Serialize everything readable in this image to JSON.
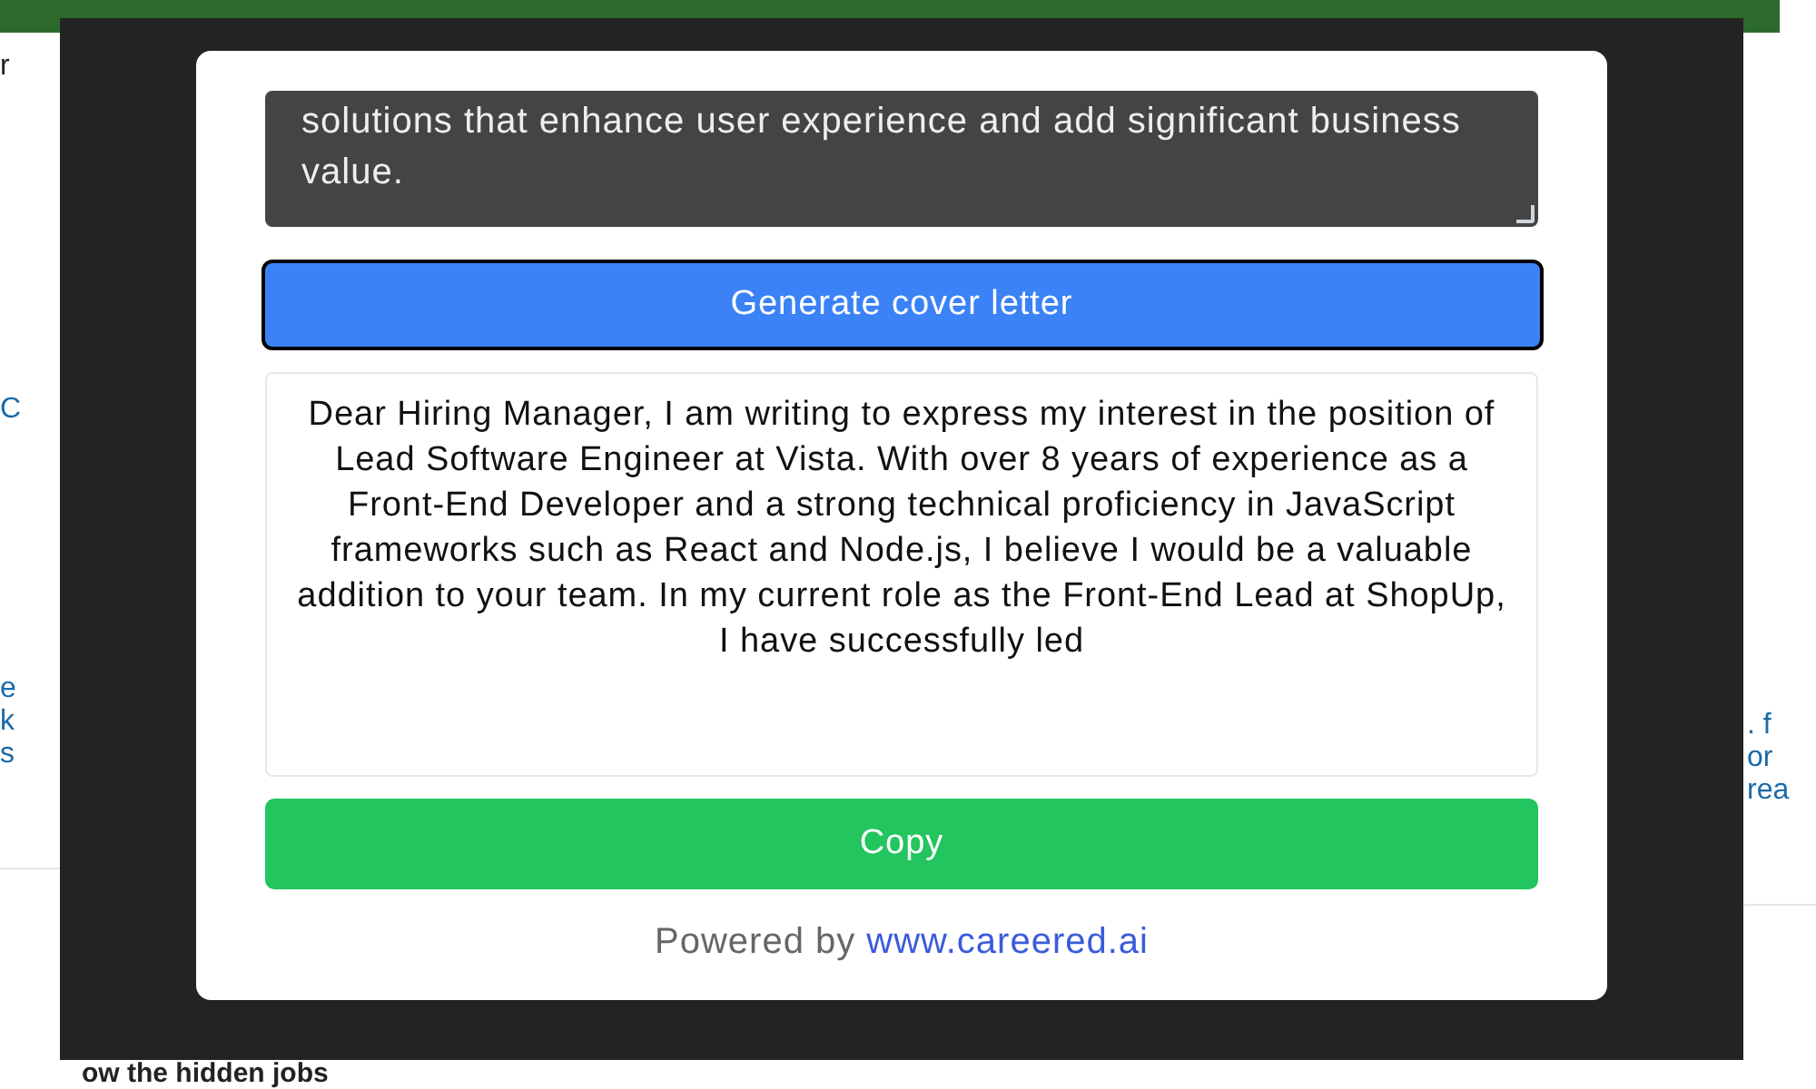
{
  "background": {
    "left_fragments": [
      {
        "text": "r",
        "kind": "heading"
      },
      {
        "text": "C",
        "kind": "link"
      },
      {
        "text": "e",
        "kind": "link"
      },
      {
        "text": "k",
        "kind": "link"
      },
      {
        "text": "s",
        "kind": "link"
      }
    ],
    "right_fragments": [
      {
        "text": ". f",
        "kind": "link"
      },
      {
        "text": "or",
        "kind": "link"
      },
      {
        "text": "rea",
        "kind": "link"
      }
    ],
    "bottom_heading": "ow the hidden jobs"
  },
  "modal": {
    "description_value": "solutions that enhance user experience and add significant business value.",
    "generate_button": "Generate cover letter",
    "cover_letter": "Dear Hiring Manager, I am writing to express my interest in the position of Lead Software Engineer at Vista. With over 8 years of experience as a Front-End Developer and a strong technical proficiency in JavaScript frameworks such as React and Node.js, I believe I would be a valuable addition to your team. In my current role as the Front-End Lead at ShopUp, I have successfully led",
    "copy_button": "Copy",
    "powered_by": "Powered by",
    "powered_link": "www.careered.ai"
  }
}
